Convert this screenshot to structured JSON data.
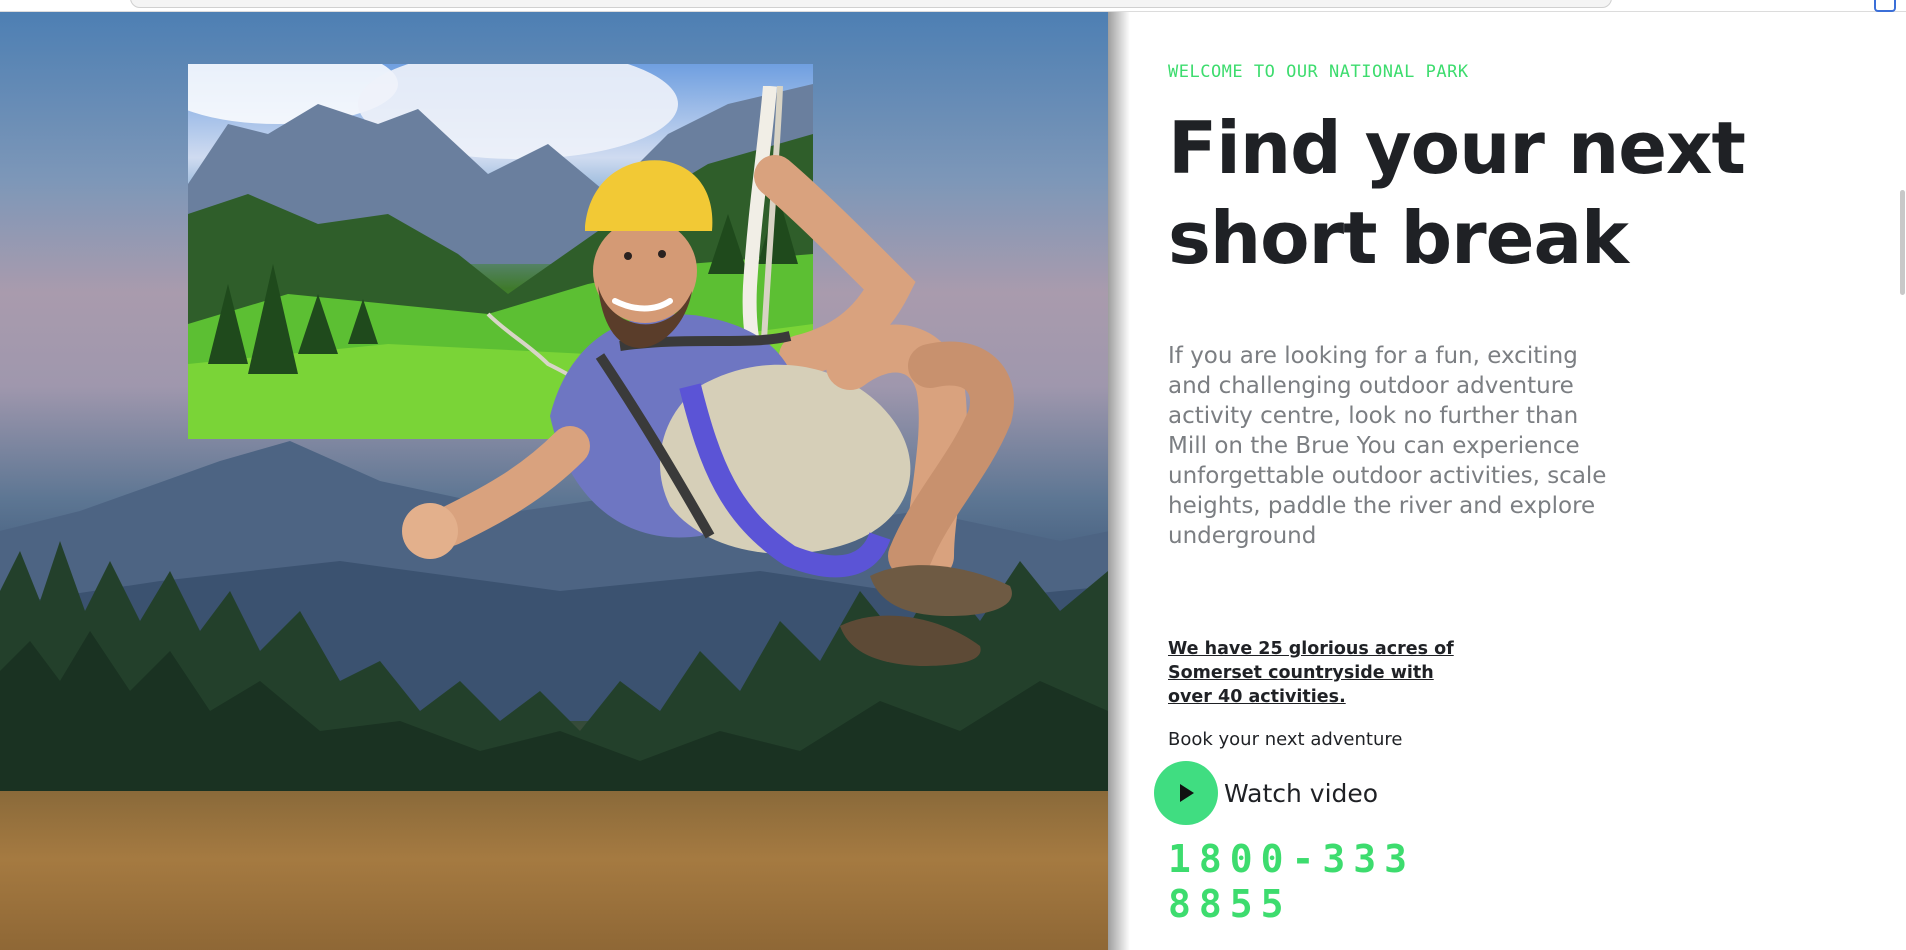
{
  "hero": {
    "inset_photo_alt": "",
    "figure_alt": ""
  },
  "content": {
    "eyebrow": "WELCOME TO OUR NATIONAL PARK",
    "headline_line1": "Find your next",
    "headline_line2": "short break",
    "intro": "If you are looking for a fun, exciting and challenging outdoor adventure activity centre, look no further than Mill on the Brue You can experience unforgettable outdoor activities, scale heights, paddle the river and explore underground",
    "acres_link": "We have 25 glorious acres of Somerset countryside with over 40 activities.",
    "book_text": "Book your next adventure",
    "watch_video_label": "Watch video",
    "phone": "1800-333 8855"
  },
  "colors": {
    "accent_green": "#3ddc6e",
    "play_button": "#40dd81",
    "heading": "#1f2125",
    "body_text": "#7b7e82"
  },
  "icons": {
    "play": "play-icon"
  }
}
